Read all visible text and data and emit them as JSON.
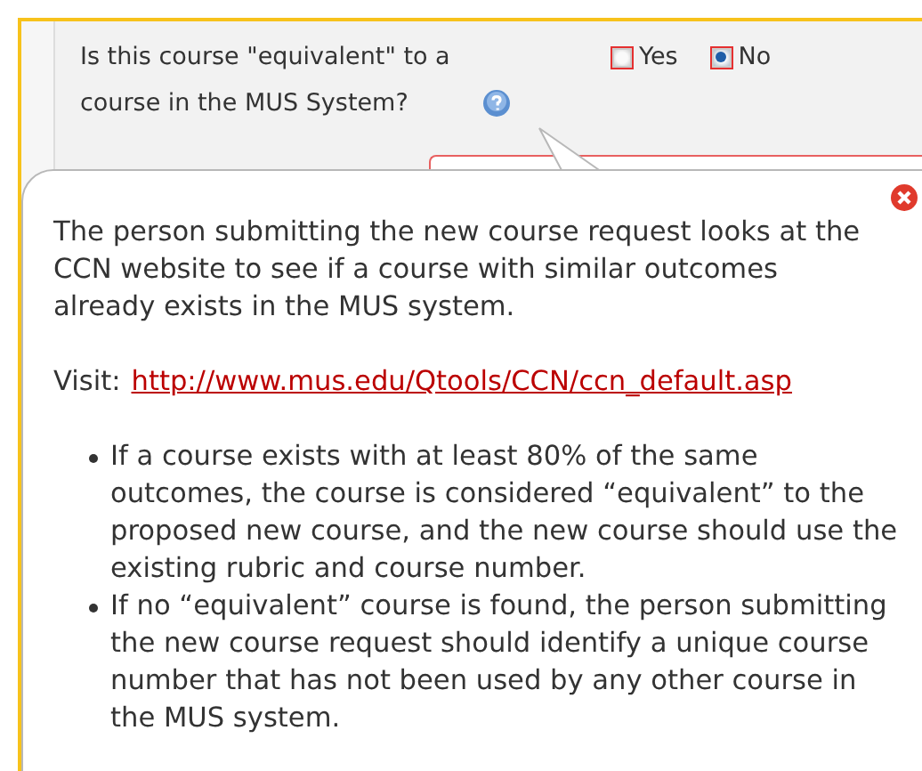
{
  "question": {
    "text": "Is this course \"equivalent\" to a course in the MUS System?",
    "options": [
      {
        "label": "Yes",
        "selected": false
      },
      {
        "label": "No",
        "selected": true
      }
    ]
  },
  "popup": {
    "intro": "The person submitting the new course request looks at the CCN website to see if a course with similar outcomes already exists in the MUS system.",
    "visit_label": "Visit:",
    "link": "http://www.mus.edu/Qtools/CCN/ccn_default.asp",
    "bullets": [
      "If a course exists with at least 80% of the same outcomes, the course is considered “equivalent” to the proposed new course, and the new course should use the existing rubric and course number.",
      "If no “equivalent” course is found, the person submitting the new course request should identify a unique course number that has not been used by any other course in the MUS system."
    ]
  }
}
